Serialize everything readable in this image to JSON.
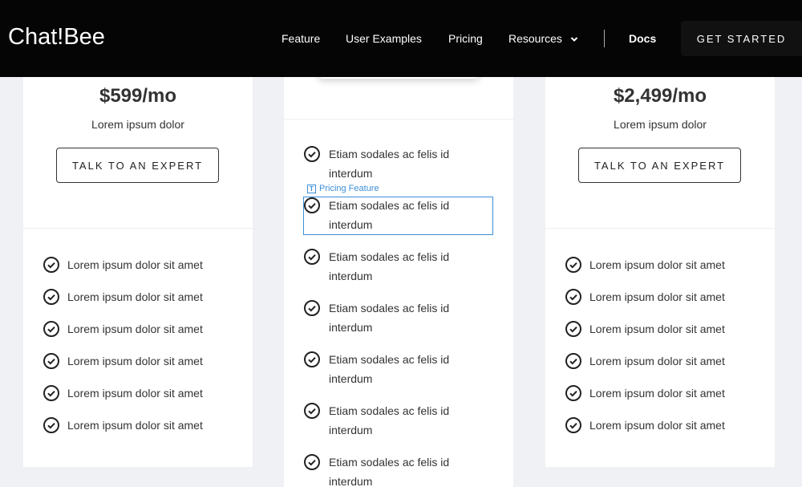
{
  "navbar": {
    "brand": "Chat!Bee",
    "links": [
      "Feature",
      "User Examples",
      "Pricing",
      "Resources"
    ],
    "docs": "Docs",
    "cta": "GET STARTED"
  },
  "plans": {
    "left": {
      "price": "$599/mo",
      "subtitle": "Lorem ipsum dolor",
      "button": "TALK TO AN EXPERT",
      "features": [
        "Lorem ipsum dolor sit amet",
        "Lorem ipsum dolor sit amet",
        "Lorem ipsum dolor sit amet",
        "Lorem ipsum dolor sit amet",
        "Lorem ipsum dolor sit amet",
        "Lorem ipsum dolor sit amet"
      ]
    },
    "middle": {
      "features": [
        "Etiam sodales ac felis id interdum",
        "Etiam sodales ac felis id interdum",
        "Etiam sodales ac felis id interdum",
        "Etiam sodales ac felis id interdum",
        "Etiam sodales ac felis id interdum",
        "Etiam sodales ac felis id interdum",
        "Etiam sodales ac felis id interdum"
      ]
    },
    "right": {
      "price": "$2,499/mo",
      "subtitle": "Lorem ipsum dolor",
      "button": "TALK TO AN EXPERT",
      "features": [
        "Lorem ipsum dolor sit amet",
        "Lorem ipsum dolor sit amet",
        "Lorem ipsum dolor sit amet",
        "Lorem ipsum dolor sit amet",
        "Lorem ipsum dolor sit amet",
        "Lorem ipsum dolor sit amet"
      ]
    }
  },
  "editor": {
    "tag_icon": "T",
    "selection_label": "Pricing Feature"
  },
  "icons": {
    "check": "check-circle-icon",
    "chevron": "chevron-down-icon"
  },
  "colors": {
    "navbar_bg": "#050505",
    "page_bg": "#f0f1f4",
    "selection": "#3b8fd9"
  }
}
